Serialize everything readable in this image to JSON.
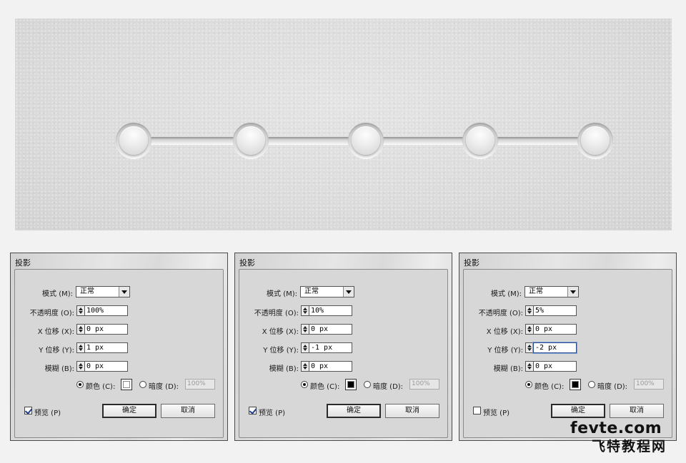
{
  "preview": {
    "steps": 5
  },
  "dialogs": [
    {
      "title": "投影",
      "mode_label": "模式 (M):",
      "mode_value": "正常",
      "opacity_label": "不透明度 (O):",
      "opacity_value": "100%",
      "x_label": "X 位移 (X):",
      "x_value": "0 px",
      "y_label": "Y 位移 (Y):",
      "y_value": "1 px",
      "blur_label": "模糊 (B):",
      "blur_value": "0 px",
      "color_label": "颜色 (C):",
      "color_swatch": "#ffffff",
      "darkness_label": "暗度 (D):",
      "darkness_value": "100%",
      "preview_label": "预览 (P)",
      "preview_checked": true,
      "ok_label": "确定",
      "cancel_label": "取消"
    },
    {
      "title": "投影",
      "mode_label": "模式 (M):",
      "mode_value": "正常",
      "opacity_label": "不透明度 (O):",
      "opacity_value": "10%",
      "x_label": "X 位移 (X):",
      "x_value": "0 px",
      "y_label": "Y 位移 (Y):",
      "y_value": "-1 px",
      "blur_label": "模糊 (B):",
      "blur_value": "0 px",
      "color_label": "颜色 (C):",
      "color_swatch": "#000000",
      "darkness_label": "暗度 (D):",
      "darkness_value": "100%",
      "preview_label": "预览 (P)",
      "preview_checked": true,
      "ok_label": "确定",
      "cancel_label": "取消"
    },
    {
      "title": "投影",
      "mode_label": "模式 (M):",
      "mode_value": "正常",
      "opacity_label": "不透明度 (O):",
      "opacity_value": "5%",
      "x_label": "X 位移 (X):",
      "x_value": "0 px",
      "y_label": "Y 位移 (Y):",
      "y_value": "-2 px",
      "blur_label": "模糊 (B):",
      "blur_value": "0 px",
      "color_label": "颜色 (C):",
      "color_swatch": "#000000",
      "darkness_label": "暗度 (D):",
      "darkness_value": "100%",
      "preview_label": "预览 (P)",
      "preview_checked": false,
      "ok_label": "确定",
      "cancel_label": "取消"
    }
  ],
  "watermark": {
    "line1": "fevte.com",
    "line2": "飞特教程网"
  }
}
